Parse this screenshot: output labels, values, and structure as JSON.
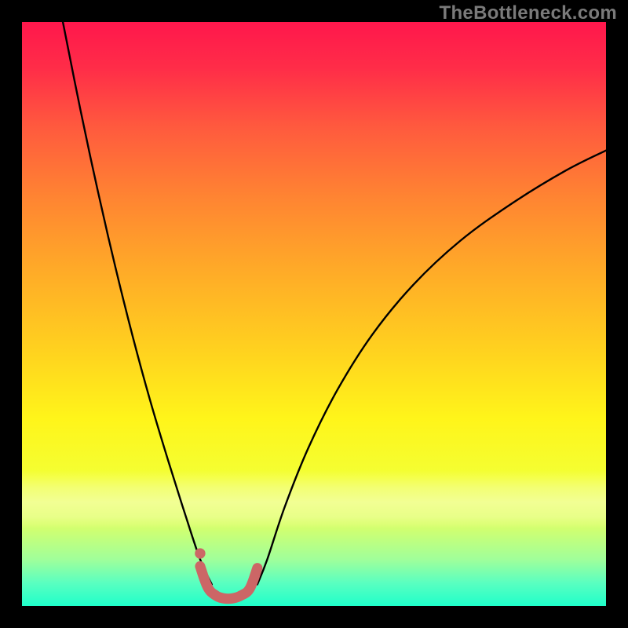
{
  "watermark": "TheBottleneck.com",
  "chart_data": {
    "type": "line",
    "title": "",
    "xlabel": "",
    "ylabel": "",
    "xlim": [
      0,
      100
    ],
    "ylim": [
      0,
      100
    ],
    "grid": false,
    "legend": false,
    "series": [
      {
        "name": "left-arm",
        "stroke": "#000000",
        "x": [
          7,
          10,
          13,
          16,
          19,
          22,
          25,
          28,
          30.5,
          32.5
        ],
        "values": [
          100,
          85,
          71,
          58,
          46,
          35,
          25,
          15.5,
          8,
          3.7
        ]
      },
      {
        "name": "right-arm",
        "stroke": "#000000",
        "x": [
          40.3,
          42,
          45,
          49,
          54,
          60,
          67,
          75,
          84,
          93,
          100
        ],
        "values": [
          3.7,
          8,
          17,
          27,
          37,
          46.5,
          55,
          62.5,
          69,
          74.5,
          78
        ]
      },
      {
        "name": "trough-highlight",
        "stroke": "#cc6666",
        "x": [
          30.5,
          31.8,
          33.2,
          34.6,
          36.0,
          37.5,
          39.0,
          40.3
        ],
        "values": [
          6.8,
          3.2,
          1.8,
          1.3,
          1.3,
          1.8,
          3.0,
          6.5
        ]
      }
    ],
    "markers": [
      {
        "name": "left-dot-upper",
        "x": 30.5,
        "y": 9.0,
        "r": 0.9,
        "fill": "#cc6666"
      },
      {
        "name": "left-dot-lower",
        "x": 31.0,
        "y": 5.4,
        "r": 0.8,
        "fill": "#cc6666"
      }
    ],
    "note": "Axes are unlabeled in the source image; x and y are normalized 0–100 across the plotting area. Values estimated from pixel positions."
  }
}
